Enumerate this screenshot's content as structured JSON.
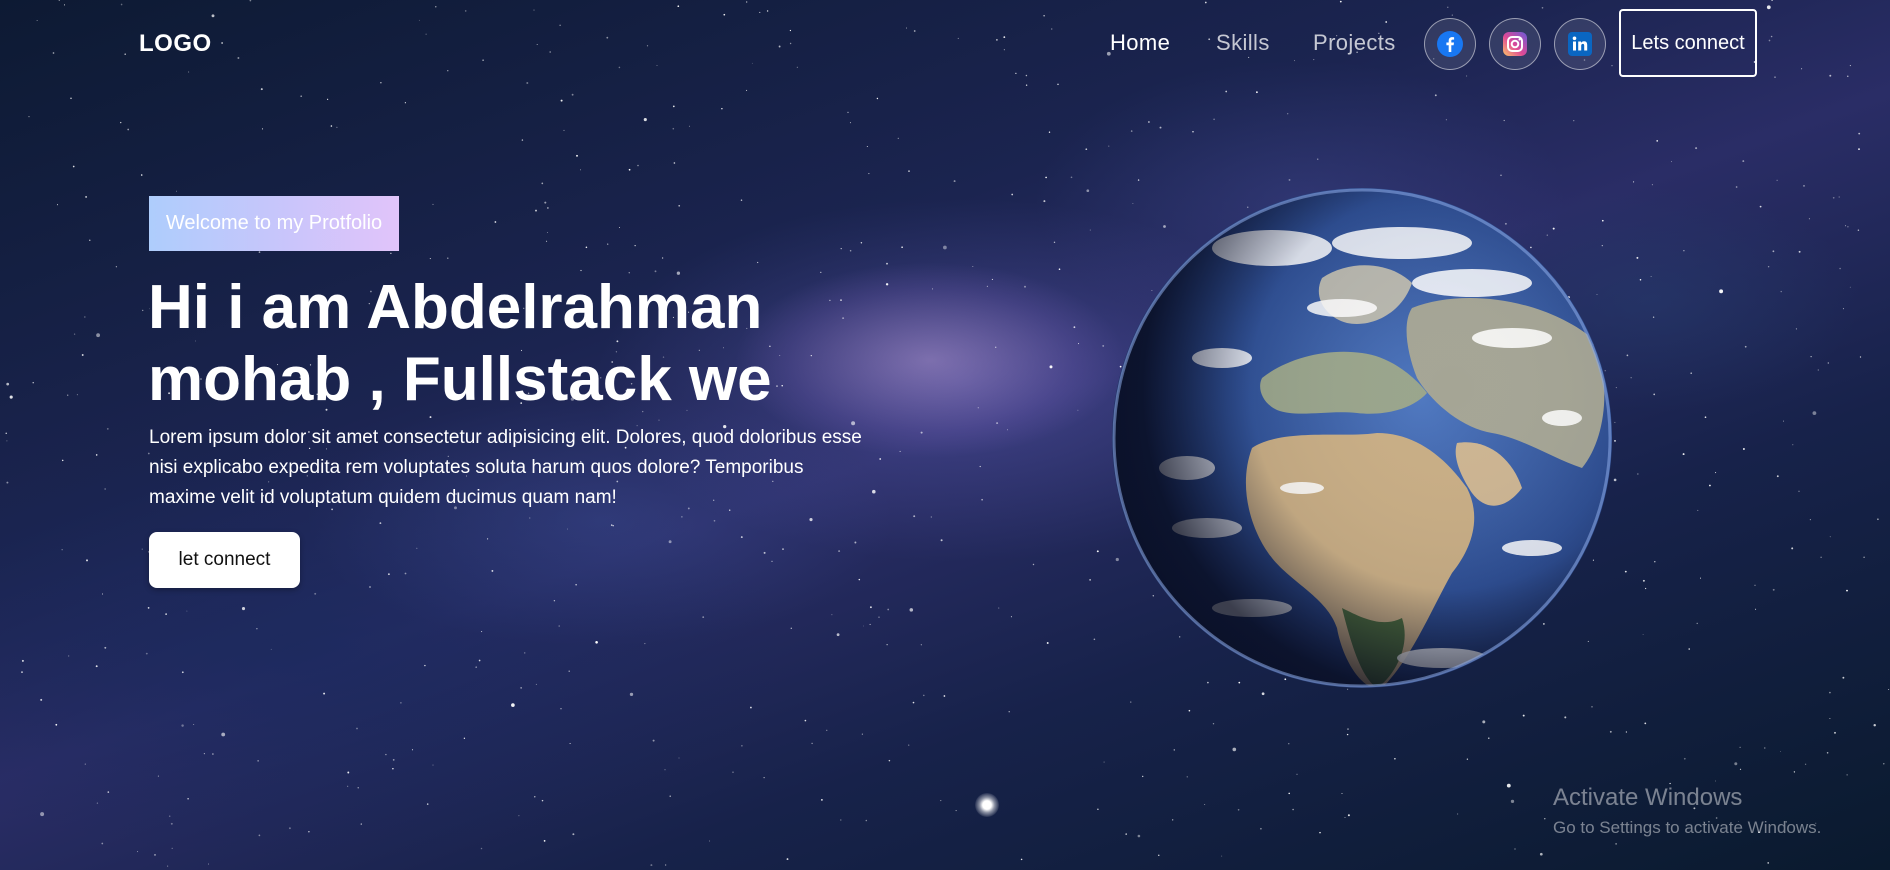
{
  "navbar": {
    "logo": "LOGO",
    "links": [
      "Home",
      "Skills",
      "Projects"
    ],
    "social": [
      "facebook-icon",
      "instagram-icon",
      "linkedin-icon"
    ],
    "cta_label": "Lets connect"
  },
  "hero": {
    "tagline": "Welcome to my Protfolio",
    "title": "Hi i am Abdelrahman mohab , Fullstack we",
    "description": "Lorem ipsum dolor sit amet consectetur adipisicing elit. Dolores, quod doloribus esse nisi explicabo expedita rem voluptates soluta harum quos dolore? Temporibus maxime velit id voluptatum quidem ducimus quam nam!",
    "cta_label": "let connect"
  },
  "watermark": {
    "title": "Activate Windows",
    "subtitle": "Go to Settings to activate Windows."
  },
  "colors": {
    "tagline_start": "#aecdfc",
    "tagline_end": "#e1c4fa",
    "facebook": "#1877f2",
    "linkedin": "#0a66c2"
  }
}
